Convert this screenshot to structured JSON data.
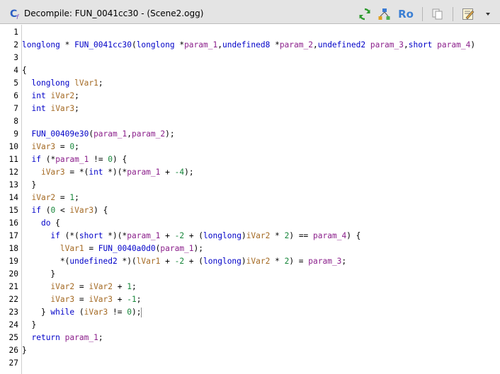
{
  "window": {
    "title": "Decompile: FUN_0041cc30 -  (Scene2.ogg)",
    "toolbar": {
      "ro_label": "Ro"
    }
  },
  "colors": {
    "keyword": "#0000c8",
    "function": "#0000c8",
    "local_variable": "#a46a24",
    "parameter": "#8b1f8b",
    "number": "#16863a",
    "text": "#000000",
    "title_bar": "#e4e4e4"
  },
  "editor": {
    "lines": [
      {
        "n": "1",
        "t": []
      },
      {
        "n": "2",
        "t": [
          {
            "c": "kw",
            "v": "longlong"
          },
          {
            "c": "txt",
            "v": " * "
          },
          {
            "c": "fn",
            "v": "FUN_0041cc30"
          },
          {
            "c": "txt",
            "v": "("
          },
          {
            "c": "kw",
            "v": "longlong"
          },
          {
            "c": "txt",
            "v": " *"
          },
          {
            "c": "prm",
            "v": "param_1"
          },
          {
            "c": "txt",
            "v": ","
          },
          {
            "c": "kw",
            "v": "undefined8"
          },
          {
            "c": "txt",
            "v": " *"
          },
          {
            "c": "prm",
            "v": "param_2"
          },
          {
            "c": "txt",
            "v": ","
          },
          {
            "c": "kw",
            "v": "undefined2"
          },
          {
            "c": "txt",
            "v": " "
          },
          {
            "c": "prm",
            "v": "param_3"
          },
          {
            "c": "txt",
            "v": ","
          },
          {
            "c": "kw",
            "v": "short"
          },
          {
            "c": "txt",
            "v": " "
          },
          {
            "c": "prm",
            "v": "param_4"
          },
          {
            "c": "txt",
            "v": ")"
          }
        ]
      },
      {
        "n": "3",
        "t": []
      },
      {
        "n": "4",
        "t": [
          {
            "c": "txt",
            "v": "{"
          }
        ]
      },
      {
        "n": "5",
        "t": [
          {
            "c": "txt",
            "v": "  "
          },
          {
            "c": "kw",
            "v": "longlong"
          },
          {
            "c": "txt",
            "v": " "
          },
          {
            "c": "var",
            "v": "lVar1"
          },
          {
            "c": "txt",
            "v": ";"
          }
        ]
      },
      {
        "n": "6",
        "t": [
          {
            "c": "txt",
            "v": "  "
          },
          {
            "c": "kw",
            "v": "int"
          },
          {
            "c": "txt",
            "v": " "
          },
          {
            "c": "var",
            "v": "iVar2"
          },
          {
            "c": "txt",
            "v": ";"
          }
        ]
      },
      {
        "n": "7",
        "t": [
          {
            "c": "txt",
            "v": "  "
          },
          {
            "c": "kw",
            "v": "int"
          },
          {
            "c": "txt",
            "v": " "
          },
          {
            "c": "var",
            "v": "iVar3"
          },
          {
            "c": "txt",
            "v": ";"
          }
        ]
      },
      {
        "n": "8",
        "t": []
      },
      {
        "n": "9",
        "t": [
          {
            "c": "txt",
            "v": "  "
          },
          {
            "c": "fn",
            "v": "FUN_00409e30"
          },
          {
            "c": "txt",
            "v": "("
          },
          {
            "c": "prm",
            "v": "param_1"
          },
          {
            "c": "txt",
            "v": ","
          },
          {
            "c": "prm",
            "v": "param_2"
          },
          {
            "c": "txt",
            "v": ");"
          }
        ]
      },
      {
        "n": "10",
        "t": [
          {
            "c": "txt",
            "v": "  "
          },
          {
            "c": "var",
            "v": "iVar3"
          },
          {
            "c": "txt",
            "v": " = "
          },
          {
            "c": "num",
            "v": "0"
          },
          {
            "c": "txt",
            "v": ";"
          }
        ]
      },
      {
        "n": "11",
        "t": [
          {
            "c": "txt",
            "v": "  "
          },
          {
            "c": "kw",
            "v": "if"
          },
          {
            "c": "txt",
            "v": " (*"
          },
          {
            "c": "prm",
            "v": "param_1"
          },
          {
            "c": "txt",
            "v": " != "
          },
          {
            "c": "num",
            "v": "0"
          },
          {
            "c": "txt",
            "v": ") {"
          }
        ]
      },
      {
        "n": "12",
        "t": [
          {
            "c": "txt",
            "v": "    "
          },
          {
            "c": "var",
            "v": "iVar3"
          },
          {
            "c": "txt",
            "v": " = *("
          },
          {
            "c": "kw",
            "v": "int"
          },
          {
            "c": "txt",
            "v": " *)(*"
          },
          {
            "c": "prm",
            "v": "param_1"
          },
          {
            "c": "txt",
            "v": " + "
          },
          {
            "c": "num",
            "v": "-4"
          },
          {
            "c": "txt",
            "v": ");"
          }
        ]
      },
      {
        "n": "13",
        "t": [
          {
            "c": "txt",
            "v": "  }"
          }
        ]
      },
      {
        "n": "14",
        "t": [
          {
            "c": "txt",
            "v": "  "
          },
          {
            "c": "var",
            "v": "iVar2"
          },
          {
            "c": "txt",
            "v": " = "
          },
          {
            "c": "num",
            "v": "1"
          },
          {
            "c": "txt",
            "v": ";"
          }
        ]
      },
      {
        "n": "15",
        "t": [
          {
            "c": "txt",
            "v": "  "
          },
          {
            "c": "kw",
            "v": "if"
          },
          {
            "c": "txt",
            "v": " ("
          },
          {
            "c": "num",
            "v": "0"
          },
          {
            "c": "txt",
            "v": " < "
          },
          {
            "c": "var",
            "v": "iVar3"
          },
          {
            "c": "txt",
            "v": ") {"
          }
        ]
      },
      {
        "n": "16",
        "t": [
          {
            "c": "txt",
            "v": "    "
          },
          {
            "c": "kw",
            "v": "do"
          },
          {
            "c": "txt",
            "v": " {"
          }
        ]
      },
      {
        "n": "17",
        "t": [
          {
            "c": "txt",
            "v": "      "
          },
          {
            "c": "kw",
            "v": "if"
          },
          {
            "c": "txt",
            "v": " (*("
          },
          {
            "c": "kw",
            "v": "short"
          },
          {
            "c": "txt",
            "v": " *)(*"
          },
          {
            "c": "prm",
            "v": "param_1"
          },
          {
            "c": "txt",
            "v": " + "
          },
          {
            "c": "num",
            "v": "-2"
          },
          {
            "c": "txt",
            "v": " + ("
          },
          {
            "c": "kw",
            "v": "longlong"
          },
          {
            "c": "txt",
            "v": ")"
          },
          {
            "c": "var",
            "v": "iVar2"
          },
          {
            "c": "txt",
            "v": " * "
          },
          {
            "c": "num",
            "v": "2"
          },
          {
            "c": "txt",
            "v": ") == "
          },
          {
            "c": "prm",
            "v": "param_4"
          },
          {
            "c": "txt",
            "v": ") {"
          }
        ]
      },
      {
        "n": "18",
        "t": [
          {
            "c": "txt",
            "v": "        "
          },
          {
            "c": "var",
            "v": "lVar1"
          },
          {
            "c": "txt",
            "v": " = "
          },
          {
            "c": "fn",
            "v": "FUN_0040a0d0"
          },
          {
            "c": "txt",
            "v": "("
          },
          {
            "c": "prm",
            "v": "param_1"
          },
          {
            "c": "txt",
            "v": ");"
          }
        ]
      },
      {
        "n": "19",
        "t": [
          {
            "c": "txt",
            "v": "        *("
          },
          {
            "c": "kw",
            "v": "undefined2"
          },
          {
            "c": "txt",
            "v": " *)("
          },
          {
            "c": "var",
            "v": "lVar1"
          },
          {
            "c": "txt",
            "v": " + "
          },
          {
            "c": "num",
            "v": "-2"
          },
          {
            "c": "txt",
            "v": " + ("
          },
          {
            "c": "kw",
            "v": "longlong"
          },
          {
            "c": "txt",
            "v": ")"
          },
          {
            "c": "var",
            "v": "iVar2"
          },
          {
            "c": "txt",
            "v": " * "
          },
          {
            "c": "num",
            "v": "2"
          },
          {
            "c": "txt",
            "v": ") = "
          },
          {
            "c": "prm",
            "v": "param_3"
          },
          {
            "c": "txt",
            "v": ";"
          }
        ]
      },
      {
        "n": "20",
        "t": [
          {
            "c": "txt",
            "v": "      }"
          }
        ]
      },
      {
        "n": "21",
        "t": [
          {
            "c": "txt",
            "v": "      "
          },
          {
            "c": "var",
            "v": "iVar2"
          },
          {
            "c": "txt",
            "v": " = "
          },
          {
            "c": "var",
            "v": "iVar2"
          },
          {
            "c": "txt",
            "v": " + "
          },
          {
            "c": "num",
            "v": "1"
          },
          {
            "c": "txt",
            "v": ";"
          }
        ]
      },
      {
        "n": "22",
        "t": [
          {
            "c": "txt",
            "v": "      "
          },
          {
            "c": "var",
            "v": "iVar3"
          },
          {
            "c": "txt",
            "v": " = "
          },
          {
            "c": "var",
            "v": "iVar3"
          },
          {
            "c": "txt",
            "v": " + "
          },
          {
            "c": "num",
            "v": "-1"
          },
          {
            "c": "txt",
            "v": ";"
          }
        ]
      },
      {
        "n": "23",
        "t": [
          {
            "c": "txt",
            "v": "    } "
          },
          {
            "c": "kw",
            "v": "while"
          },
          {
            "c": "txt",
            "v": " ("
          },
          {
            "c": "var",
            "v": "iVar3"
          },
          {
            "c": "txt",
            "v": " != "
          },
          {
            "c": "num",
            "v": "0"
          },
          {
            "c": "txt",
            "v": ");"
          }
        ],
        "caret": true
      },
      {
        "n": "24",
        "t": [
          {
            "c": "txt",
            "v": "  }"
          }
        ]
      },
      {
        "n": "25",
        "t": [
          {
            "c": "txt",
            "v": "  "
          },
          {
            "c": "kw",
            "v": "return"
          },
          {
            "c": "txt",
            "v": " "
          },
          {
            "c": "prm",
            "v": "param_1"
          },
          {
            "c": "txt",
            "v": ";"
          }
        ]
      },
      {
        "n": "26",
        "t": [
          {
            "c": "txt",
            "v": "}"
          }
        ]
      },
      {
        "n": "27",
        "t": []
      }
    ]
  }
}
